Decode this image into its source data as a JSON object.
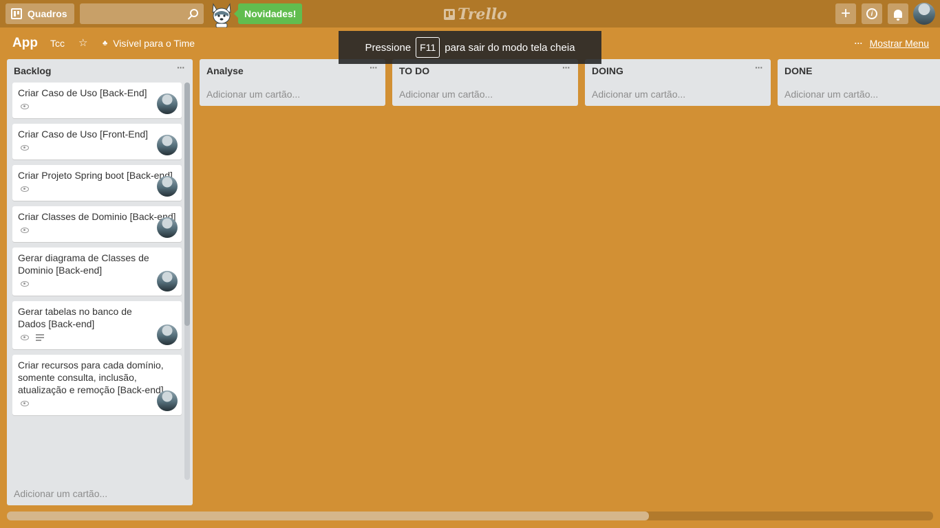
{
  "header": {
    "boards_label": "Quadros",
    "search_placeholder": "",
    "novidades_label": "Novidades!",
    "logo_text": "Trello",
    "add_label": "+"
  },
  "board": {
    "title": "App",
    "team": "Tcc",
    "visibility": "Visível para o Time",
    "show_menu": "Mostrar Menu"
  },
  "toast": {
    "before": "Pressione",
    "key": "F11",
    "after": "para sair do modo tela cheia"
  },
  "lists": [
    {
      "name": "Backlog",
      "add_label": "Adicionar um cartão...",
      "cards": [
        {
          "title": "Criar Caso de Uso [Back-End]",
          "has_description": false
        },
        {
          "title": "Criar Caso de Uso [Front-End]",
          "has_description": false
        },
        {
          "title": "Criar Projeto Spring boot [Back-end]",
          "has_description": false
        },
        {
          "title": "Criar Classes de Dominio [Back-end]",
          "has_description": false
        },
        {
          "title": "Gerar diagrama de Classes de Dominio [Back-end]",
          "has_description": false
        },
        {
          "title": "Gerar tabelas no banco de Dados [Back-end]",
          "has_description": true
        },
        {
          "title": "Criar recursos para cada domínio, somente consulta, inclusão, atualização e remoção [Back-end]",
          "has_description": false
        }
      ]
    },
    {
      "name": "Analyse",
      "add_label": "Adicionar um cartão...",
      "cards": []
    },
    {
      "name": "TO DO",
      "add_label": "Adicionar um cartão...",
      "cards": []
    },
    {
      "name": "DOING",
      "add_label": "Adicionar um cartão...",
      "cards": []
    },
    {
      "name": "DONE",
      "add_label": "Adicionar um cartão...",
      "cards": []
    }
  ],
  "colors": {
    "board_background": "#d29034",
    "header_background": "#b07828",
    "novidades_green": "#61bd4f",
    "list_background": "#e2e4e6"
  },
  "icons": {
    "boards": "boards-icon",
    "search": "search-icon",
    "star": "star-icon",
    "visibility": "team-visibility-icon",
    "card_watch": "eye-icon",
    "card_description": "description-icon"
  }
}
